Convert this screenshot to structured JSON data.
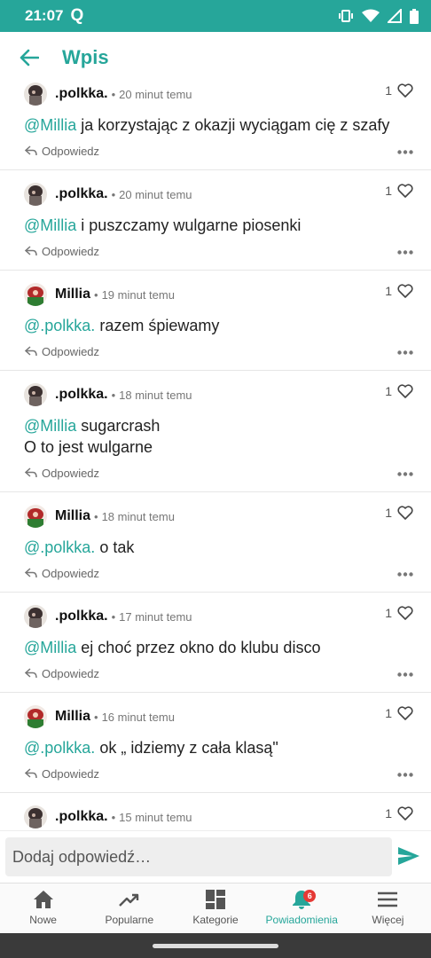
{
  "status_bar": {
    "time": "21:07",
    "app_glyph": "Q"
  },
  "header": {
    "title": "Wpis"
  },
  "reply_label": "Odpowiedz",
  "comments": [
    {
      "author": ".polkka.",
      "time": "20 minut temu",
      "likes": "1",
      "mention": "@Millia",
      "text": "ja korzystając z okazji wyciągam cię z szafy"
    },
    {
      "author": ".polkka.",
      "time": "20 minut temu",
      "likes": "1",
      "mention": "@Millia",
      "text": "i puszczamy wulgarne piosenki"
    },
    {
      "author": "Millia",
      "time": "19 minut temu",
      "likes": "1",
      "mention": "@.polkka.",
      "text": "razem śpiewamy"
    },
    {
      "author": ".polkka.",
      "time": "18 minut temu",
      "likes": "1",
      "mention": "@Millia",
      "text": "sugarcrash",
      "text2": "O to jest wulgarne"
    },
    {
      "author": "Millia",
      "time": "18 minut temu",
      "likes": "1",
      "mention": "@.polkka.",
      "text": "o tak"
    },
    {
      "author": ".polkka.",
      "time": "17 minut temu",
      "likes": "1",
      "mention": "@Millia",
      "text": "ej choć przez okno do klubu disco"
    },
    {
      "author": "Millia",
      "time": "16 minut temu",
      "likes": "1",
      "mention": "@.polkka.",
      "text": "ok „ idziemy z cała klasą\""
    },
    {
      "author": ".polkka.",
      "time": "15 minut temu",
      "likes": "1"
    }
  ],
  "composer": {
    "placeholder": "Dodaj odpowiedź…"
  },
  "bottom_nav": [
    {
      "label": "Nowe",
      "icon": "home-icon"
    },
    {
      "label": "Popularne",
      "icon": "trending-icon"
    },
    {
      "label": "Kategorie",
      "icon": "grid-icon"
    },
    {
      "label": "Powiadomienia",
      "icon": "bell-icon",
      "badge": "6",
      "active": true
    },
    {
      "label": "Więcej",
      "icon": "menu-icon"
    }
  ],
  "colors": {
    "accent": "#26a69a",
    "badge": "#e53935"
  }
}
